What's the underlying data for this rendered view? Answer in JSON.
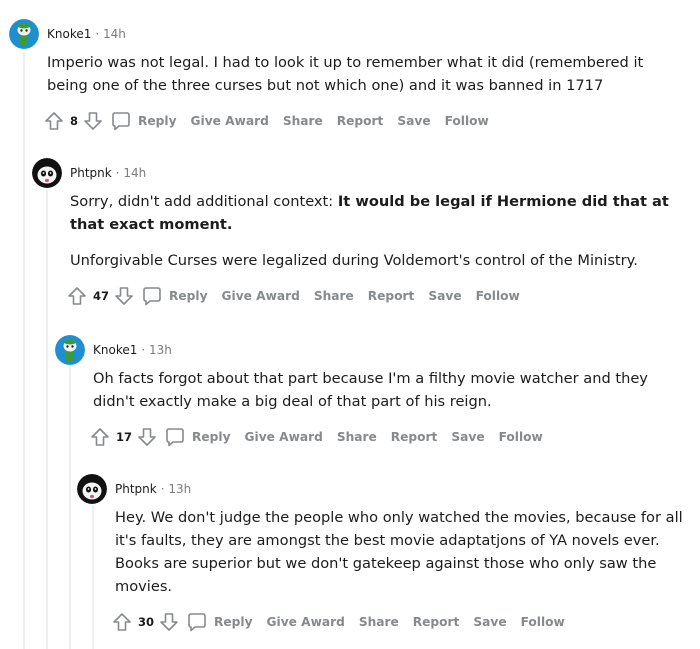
{
  "comments": [
    {
      "author": "Knoke1",
      "age": "14h",
      "avatar_icon": "snoo-avatar-green-icon",
      "paragraphs": [
        {
          "text": "Imperio was not legal. I had to look it up to remember what it did (remembered it being one of the three curses but not which one) and it was banned in 1717"
        }
      ],
      "score": "8"
    },
    {
      "author": "Phtpnk",
      "age": "14h",
      "avatar_icon": "snoo-avatar-panda-icon",
      "paragraphs": [
        {
          "prefix": "Sorry, didn't add additional context: ",
          "bold": "It would be legal if Hermione did that at that exact moment."
        },
        {
          "text": "Unforgivable Curses were legalized during Voldemort's control of the Ministry."
        }
      ],
      "score": "47"
    },
    {
      "author": "Knoke1",
      "age": "13h",
      "avatar_icon": "snoo-avatar-green-icon",
      "paragraphs": [
        {
          "text": "Oh facts forgot about that part because I'm a filthy movie watcher and they didn't exactly make a big deal of that part of his reign."
        }
      ],
      "score": "17"
    },
    {
      "author": "Phtpnk",
      "age": "13h",
      "avatar_icon": "snoo-avatar-panda-icon",
      "paragraphs": [
        {
          "text": "Hey. We don't judge the people who only watched the movies, because for all it's faults, they are amongst the best movie adaptatjons of YA novels ever. Books are superior but we don't gatekeep against those who only saw the movies."
        }
      ],
      "score": "30"
    }
  ],
  "actions": {
    "reply": "Reply",
    "give_award": "Give Award",
    "share": "Share",
    "report": "Report",
    "save": "Save",
    "follow": "Follow"
  },
  "meta_separator": "·",
  "colors": {
    "text": "#1c1c1c",
    "muted": "#878a8c",
    "thread_line": "#edeff1",
    "avatar_green_bg": "#1f8fd1"
  }
}
